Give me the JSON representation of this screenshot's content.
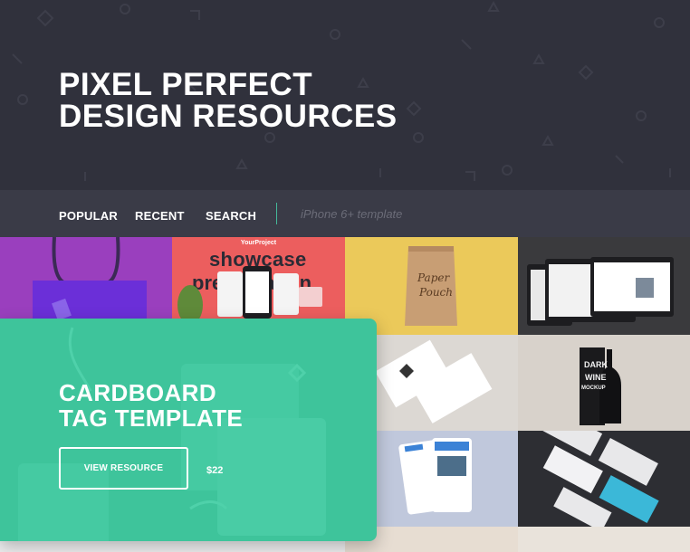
{
  "hero": {
    "title_line1": "PIXEL PERFECT",
    "title_line2": "DESIGN RESOURCES"
  },
  "nav": {
    "items": [
      "POPULAR",
      "RECENT",
      "SEARCH"
    ],
    "search_placeholder": "iPhone 6+ template"
  },
  "tiles": {
    "showcase_brand": "YourProject",
    "showcase_title_1": "showcase",
    "showcase_title_2": "presentation",
    "pouch_text_1": "Paper",
    "pouch_text_2": "Pouch",
    "wine_text_1": "DARK",
    "wine_text_2": "WINE",
    "wine_text_3": "MOCKUP"
  },
  "feature": {
    "title_line1": "CARDBOARD",
    "title_line2": "TAG TEMPLATE",
    "button_label": "VIEW RESOURCE",
    "price": "$22",
    "accent_color": "#3ec49b"
  },
  "colors": {
    "hero_bg": "#30313c",
    "nav_bg": "#3a3b47",
    "nav_divider": "#44b89a"
  }
}
